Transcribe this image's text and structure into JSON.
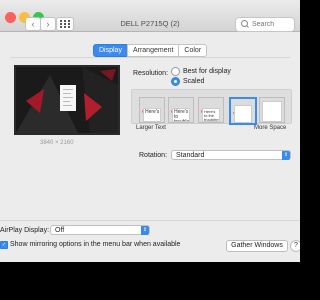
{
  "window": {
    "title": "DELL P2715Q (2)",
    "search_placeholder": "Search",
    "traffic_colors": [
      "#fc605c",
      "#fdbc40",
      "#34c84a"
    ]
  },
  "nav": {
    "back": "‹",
    "forward": "›"
  },
  "tabs": [
    {
      "label": "Display",
      "selected": true
    },
    {
      "label": "Arrangement",
      "selected": false
    },
    {
      "label": "Color",
      "selected": false
    }
  ],
  "preview": {
    "resolution_text": "3840 × 2160"
  },
  "resolution": {
    "label": "Resolution:",
    "options": [
      {
        "label": "Best for display",
        "selected": false
      },
      {
        "label": "Scaled",
        "selected": true
      }
    ]
  },
  "scaling": {
    "options": [
      {
        "text": "Here's",
        "selected": false
      },
      {
        "text": "Here's to troublem",
        "selected": false
      },
      {
        "text": "Here's to the troublemakers. The rebels.",
        "selected": false
      },
      {
        "text": "",
        "selected": true
      },
      {
        "text": "",
        "selected": false
      }
    ],
    "left_label": "Larger Text",
    "right_label": "More Space"
  },
  "rotation": {
    "label": "Rotation:",
    "value": "Standard"
  },
  "airplay": {
    "label": "AirPlay Display:",
    "value": "Off"
  },
  "mirroring": {
    "label": "Show mirroring options in the menu bar when available",
    "checked": true
  },
  "buttons": {
    "gather": "Gather Windows",
    "help": "?"
  },
  "colors": {
    "accent": "#3b8bed",
    "window_bg": "#ececec"
  }
}
